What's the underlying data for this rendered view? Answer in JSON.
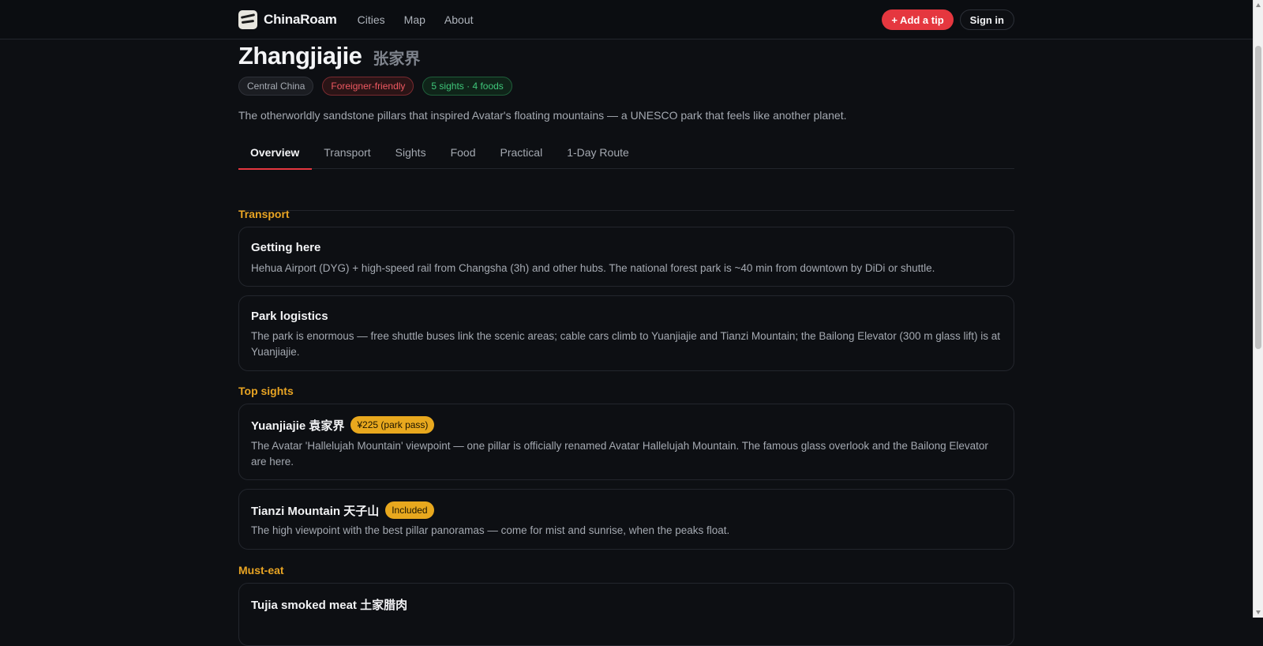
{
  "app": {
    "brand": "ChinaRoam"
  },
  "nav": {
    "links": [
      "Cities",
      "Map",
      "About"
    ],
    "add_tip": "+ Add a tip",
    "sign_in": "Sign in"
  },
  "city": {
    "name": "Zhangjiajie",
    "name_cn": "张家界",
    "tags": [
      "Central China",
      "Foreigner-friendly",
      "5 sights · 4 foods"
    ],
    "tagline": "The otherworldly sandstone pillars that inspired Avatar's floating mountains — a UNESCO park that feels like another planet."
  },
  "tabs": [
    "Overview",
    "Transport",
    "Sights",
    "Food",
    "Practical",
    "1-Day Route"
  ],
  "active_tab": "Overview",
  "sections": {
    "transport": {
      "heading": "Transport",
      "cards": [
        {
          "title": "Getting here",
          "body": "Hehua Airport (DYG) + high-speed rail from Changsha (3h) and other hubs. The national forest park is ~40 min from downtown by DiDi or shuttle."
        },
        {
          "title": "Park logistics",
          "body": "The park is enormous — free shuttle buses link the scenic areas; cable cars climb to Yuanjiajie and Tianzi Mountain; the Bailong Elevator (300 m glass lift) is at Yuanjiajie."
        }
      ]
    },
    "sights": {
      "heading": "Top sights",
      "cards": [
        {
          "title": "Yuanjiajie 袁家界",
          "badge": "¥225 (park pass)",
          "body": "The Avatar 'Hallelujah Mountain' viewpoint — one pillar is officially renamed Avatar Hallelujah Mountain. The famous glass overlook and the Bailong Elevator are here."
        },
        {
          "title": "Tianzi Mountain 天子山",
          "badge": "Included",
          "body": "The high viewpoint with the best pillar panoramas — come for mist and sunrise, when the peaks float."
        }
      ]
    },
    "food": {
      "heading": "Must-eat",
      "cards": [
        {
          "title": "Tujia smoked meat 土家腊肉"
        }
      ]
    }
  },
  "colors": {
    "accent": "#e5373f",
    "section": "#e8a423",
    "badge": "#e8a81e",
    "background": "#0d0f13"
  }
}
